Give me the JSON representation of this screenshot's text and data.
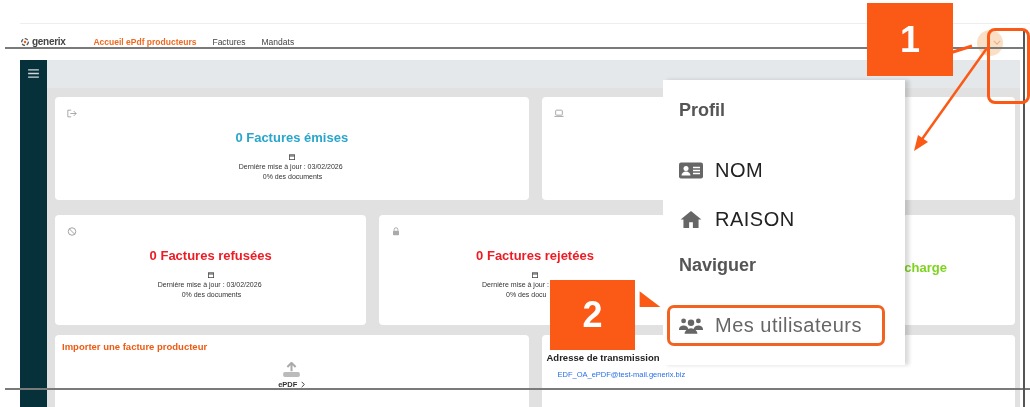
{
  "header": {
    "logo": "generix",
    "nav": [
      {
        "label": "Accueil ePdf producteurs",
        "selected": true
      },
      {
        "label": "Factures",
        "selected": false
      },
      {
        "label": "Mandats",
        "selected": false
      }
    ]
  },
  "stat_rows": [
    [
      {
        "kind": "exit",
        "title": "0 Factures émises",
        "color": "#29a6cc",
        "updated": "Dernière mise à jour : 03/02/2026",
        "share": "0% des documents"
      },
      {
        "kind": "laptop"
      }
    ],
    [
      {
        "kind": "ban",
        "title": "0 Factures refusées",
        "color": "#ec1c24",
        "updated": "Dernière mise à jour : 03/02/2026",
        "share": "0% des documents"
      },
      {
        "kind": "lock",
        "title": "0 Factures rejetées",
        "color": "#ec1c24",
        "updated": "Dernière mise à jour :",
        "share": "0% des docu"
      },
      {
        "kind": "plain",
        "title": "charge",
        "color": "#7ed321"
      }
    ]
  ],
  "import_panel": {
    "title": "Importer une facture producteur",
    "button": "ePDF"
  },
  "address_panel": {
    "title": "Adresse de transmission",
    "email": "EDF_OA_ePDF@test-mail.generix.biz"
  },
  "user_menu": {
    "sections": [
      {
        "heading": "Profil",
        "items": [
          {
            "kind": "id-card",
            "label": "NOM",
            "highlighted": false
          },
          {
            "kind": "home",
            "label": "RAISON",
            "highlighted": false
          }
        ]
      },
      {
        "heading": "Naviguer",
        "items": [
          {
            "kind": "users",
            "label": "Mes utilisateurs",
            "highlighted": true
          }
        ]
      }
    ]
  },
  "callouts": [
    {
      "number": "1"
    },
    {
      "number": "2"
    }
  ]
}
